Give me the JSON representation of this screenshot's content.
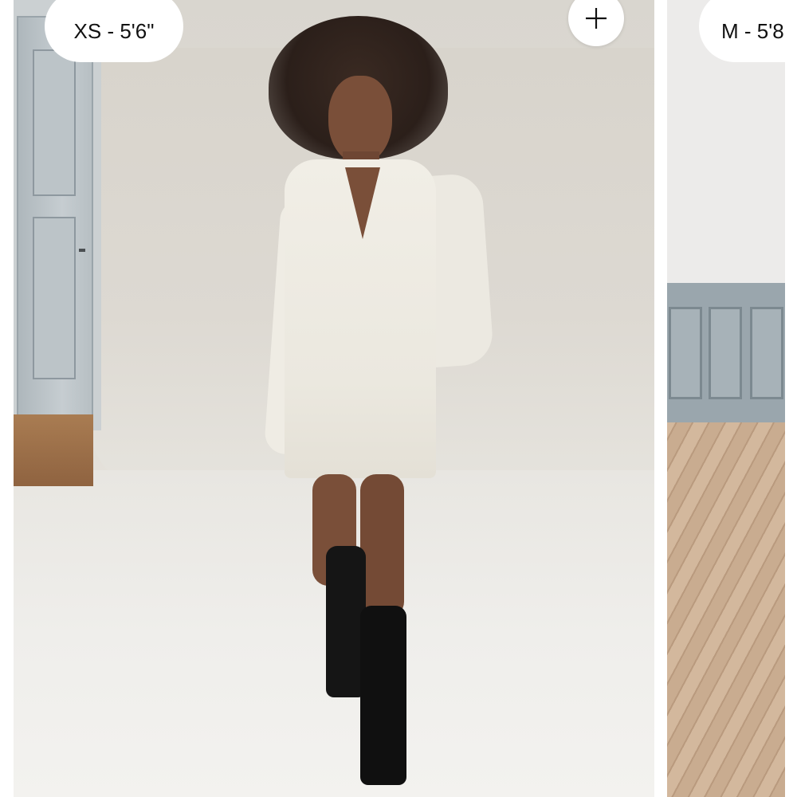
{
  "gallery": {
    "cards": [
      {
        "size_label": "XS - 5'6\"",
        "image_alt": "Model wearing white long-sleeve polo mini dress with black knee-high boots"
      },
      {
        "size_label": "M - 5'8",
        "image_alt": "Room with grey wainscoting and wooden floor"
      }
    ],
    "add_button": {
      "icon": "plus-icon"
    }
  },
  "colors": {
    "pill_background": "#ffffff",
    "pill_text": "#111111",
    "dress": "#efece4",
    "boots": "#151515",
    "wainscot": "#9aa6ad"
  }
}
